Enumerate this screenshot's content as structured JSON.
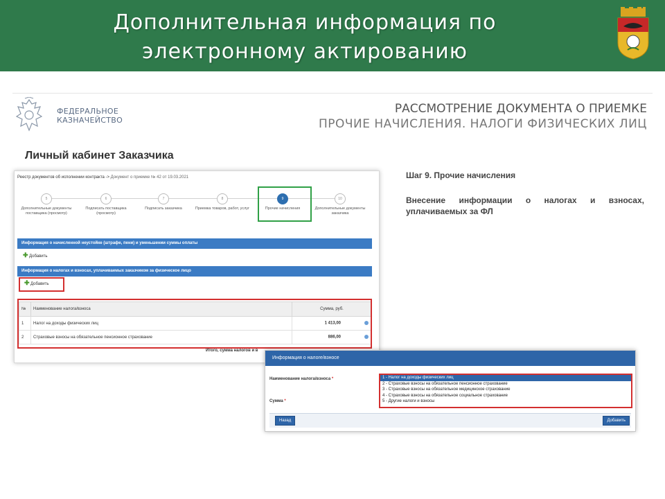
{
  "banner": {
    "title_line1": "Дополнительная информация по",
    "title_line2": "электронному актированию",
    "color": "#2f7a4b"
  },
  "header": {
    "org_line1": "ФЕДЕРАЛЬНОЕ",
    "org_line2": "КАЗНАЧЕЙСТВО",
    "doc_title_line1": "РАССМОТРЕНИЕ ДОКУМЕНТА О ПРИЕМКЕ",
    "doc_title_line2": "ПРОЧИЕ НАЧИСЛЕНИЯ. НАЛОГИ ФИЗИЧЕСКИХ ЛИЦ"
  },
  "cabinet_title": "Личный кабинет Заказчика",
  "instructions": {
    "step": "Шаг 9. Прочие начисления",
    "description": "Внесение информации о налогах и взносах, уплачиваемых за ФЛ"
  },
  "app": {
    "breadcrumb_link": "Реестр документов об исполнении контракта ->",
    "breadcrumb_current": "Документ о приемке № 42 от 19.03.2021",
    "steps": [
      {
        "num": "5",
        "label": "Дополнительные документы поставщика (просмотр)",
        "active": false
      },
      {
        "num": "6",
        "label": "Подписать поставщика (просмотр)",
        "active": false
      },
      {
        "num": "7",
        "label": "Подписать заказчика",
        "active": false
      },
      {
        "num": "8",
        "label": "Приемка товаров, работ, услуг",
        "active": false
      },
      {
        "num": "9",
        "label": "Прочие начисления",
        "active": true
      },
      {
        "num": "10",
        "label": "Дополнительные документы заказчика",
        "active": false
      }
    ],
    "penalty_section": "Информация о начисленной неустойке (штрафе, пени) и уменьшении суммы оплаты",
    "add_label_1": "Добавить",
    "tax_section": "Информация о налогах и взносах, уплачиваемых заказчиком за физическое лицо",
    "add_label_2": "Добавить",
    "table": {
      "headers": [
        "№",
        "Наименование налога/взноса",
        "Сумма, руб."
      ],
      "rows": [
        {
          "n": "1",
          "name": "Налог на доходы физических лиц",
          "sum": "1 413,00"
        },
        {
          "n": "2",
          "name": "Страховые взносы на обязательное пенсионное страхование",
          "sum": "886,00"
        }
      ]
    },
    "total_label": "Итого, сумма налогов и в"
  },
  "modal": {
    "title": "Информация о налоге/взносе",
    "name_label": "Наименование налога/взноса",
    "sum_label": "Сумма",
    "required_mark": "*",
    "options": [
      "1 - Налог на доходы физических лиц",
      "2 - Страховые взносы на обязательное пенсионное страхование",
      "3 - Страховые взносы на обязательное медицинское страхование",
      "4 - Страховые взносы на обязательное социальное страхование",
      "5 - Другие налоги и взносы"
    ],
    "selected_index": 0,
    "back_button": "Назад",
    "add_button": "Добавить"
  },
  "colors": {
    "accent_blue": "#2e65a8",
    "highlight_red": "#d32f2f",
    "highlight_green": "#2fa046"
  }
}
